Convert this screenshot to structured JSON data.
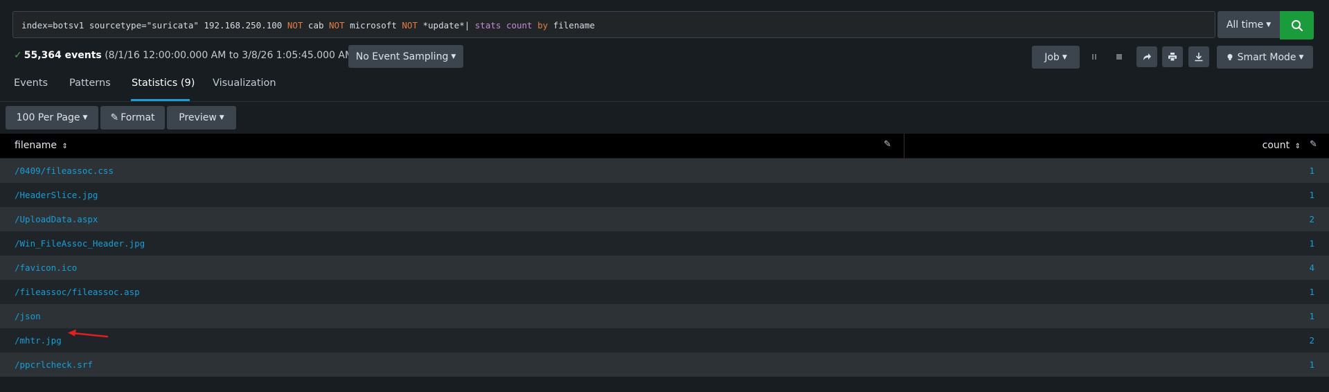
{
  "search": {
    "query_parts": [
      {
        "text": "index=botsv1 sourcetype=\"suricata\" 192.168.250.100 ",
        "kind": "plain"
      },
      {
        "text": "NOT",
        "kind": "not"
      },
      {
        "text": " cab ",
        "kind": "plain"
      },
      {
        "text": "NOT",
        "kind": "not"
      },
      {
        "text": " microsoft ",
        "kind": "plain"
      },
      {
        "text": "NOT",
        "kind": "not"
      },
      {
        "text": " *update*| ",
        "kind": "plain"
      },
      {
        "text": "stats",
        "kind": "cmd"
      },
      {
        "text": " ",
        "kind": "plain"
      },
      {
        "text": "count",
        "kind": "cmd"
      },
      {
        "text": " ",
        "kind": "plain"
      },
      {
        "text": "by",
        "kind": "by"
      },
      {
        "text": " filename",
        "kind": "plain"
      }
    ],
    "time_range": "All time",
    "search_icon": "search-icon"
  },
  "status": {
    "event_count": "55,364 events",
    "time_span": "(8/1/16 12:00:00.000 AM to 3/8/26 1:05:45.000 AM)",
    "sampling": "No Event Sampling"
  },
  "job_controls": {
    "job_label": "Job",
    "pause_icon": "pause-icon",
    "stop_icon": "stop-icon",
    "share_icon": "share-icon",
    "print_icon": "print-icon",
    "export_icon": "download-icon",
    "mode_label": "Smart Mode"
  },
  "tabs": [
    {
      "label": "Events",
      "active": false
    },
    {
      "label": "Patterns",
      "active": false
    },
    {
      "label": "Statistics (9)",
      "active": true
    },
    {
      "label": "Visualization",
      "active": false
    }
  ],
  "toolbar": {
    "per_page": "100 Per Page",
    "format": "Format",
    "preview": "Preview"
  },
  "table": {
    "columns": [
      "filename",
      "count"
    ],
    "rows": [
      {
        "filename": "/0409/fileassoc.css",
        "count": "1"
      },
      {
        "filename": "/HeaderSlice.jpg",
        "count": "1"
      },
      {
        "filename": "/UploadData.aspx",
        "count": "2"
      },
      {
        "filename": "/Win_FileAssoc_Header.jpg",
        "count": "1"
      },
      {
        "filename": "/favicon.ico",
        "count": "4"
      },
      {
        "filename": "/fileassoc/fileassoc.asp",
        "count": "1"
      },
      {
        "filename": "/json",
        "count": "1"
      },
      {
        "filename": "/mhtr.jpg",
        "count": "2"
      },
      {
        "filename": "/ppcrlcheck.srf",
        "count": "1"
      }
    ]
  },
  "colors": {
    "accent": "#1a9ed6",
    "search_button": "#1a9c3c",
    "annotation_arrow": "#e02020"
  }
}
